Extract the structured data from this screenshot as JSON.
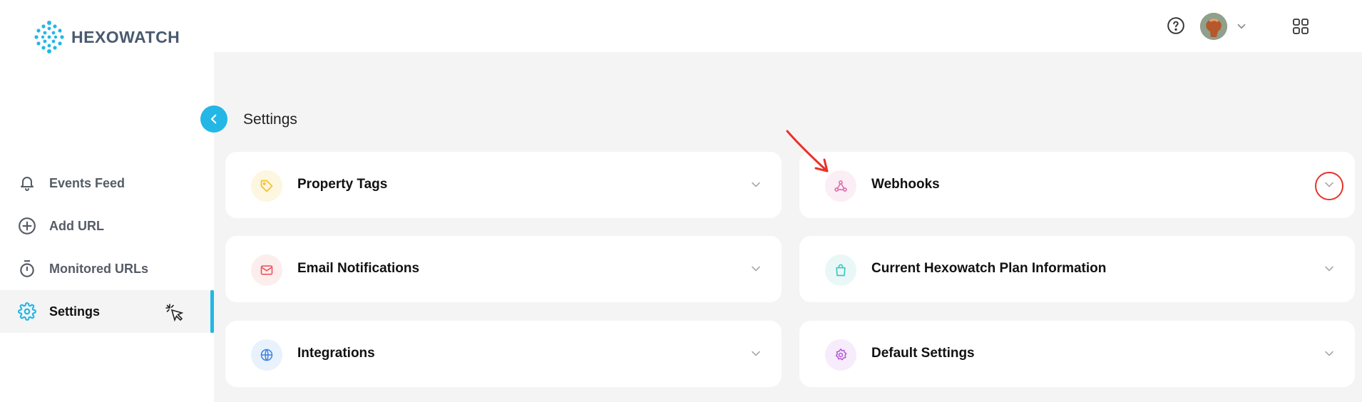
{
  "brand": {
    "name": "HEXOWATCH",
    "accent": "#23b7e5"
  },
  "sidebar": {
    "items": [
      {
        "label": "Events Feed",
        "icon": "bell-icon"
      },
      {
        "label": "Add URL",
        "icon": "plus-circle-icon"
      },
      {
        "label": "Monitored URLs",
        "icon": "stopwatch-icon"
      },
      {
        "label": "Settings",
        "icon": "gear-icon",
        "active": true
      }
    ]
  },
  "header": {
    "icons": [
      "help-icon",
      "avatar",
      "chevron-down-icon",
      "apps-grid-icon"
    ]
  },
  "main": {
    "title": "Settings",
    "cards": [
      {
        "label": "Property Tags",
        "icon": "tag-icon",
        "color": "#f5c22b"
      },
      {
        "label": "Webhooks",
        "icon": "webhook-icon",
        "color": "#e05fa8"
      },
      {
        "label": "Email Notifications",
        "icon": "envelope-icon",
        "color": "#f0565a"
      },
      {
        "label": "Current Hexowatch Plan Information",
        "icon": "shopping-bag-icon",
        "color": "#3ec6c0"
      },
      {
        "label": "Integrations",
        "icon": "globe-icon",
        "color": "#3b82e0"
      },
      {
        "label": "Default Settings",
        "icon": "gear-icon",
        "color": "#b455d9"
      }
    ]
  },
  "annotations": {
    "color": "#e8322a"
  }
}
